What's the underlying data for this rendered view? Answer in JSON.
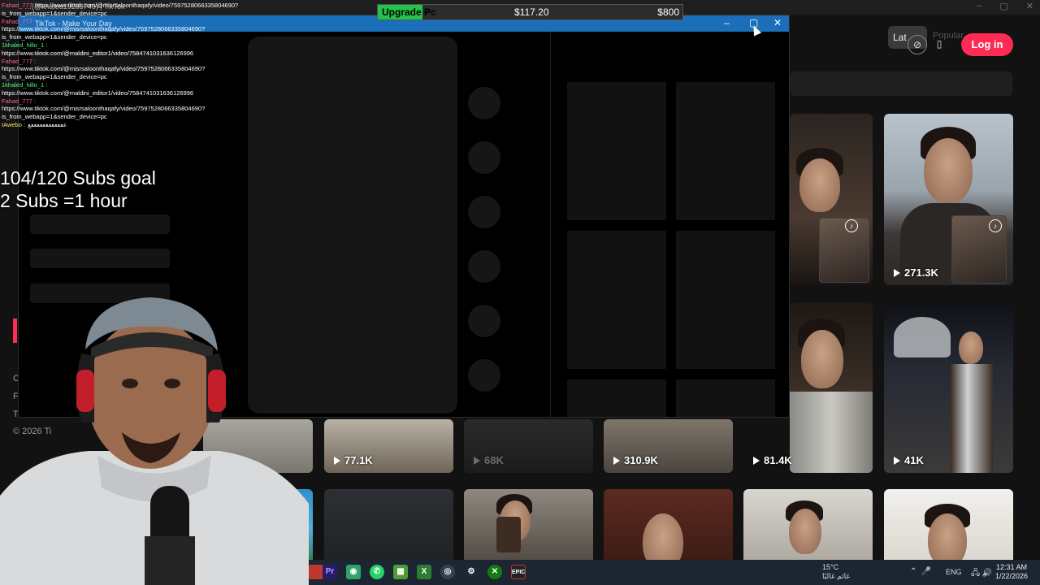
{
  "browser": {
    "title": "…(@khaled19283746) | TikTok",
    "window_title": "TikTok - Make Your Day"
  },
  "upgrade": {
    "label": "Upgrade Pc",
    "current": "$117.20",
    "goal": "$800",
    "progress": 0.1465
  },
  "tiktok": {
    "tab_latest": "Lat",
    "tab_popular": "Popular",
    "login_label": "Log in",
    "side_labels": [
      "C",
      "F",
      "T"
    ],
    "copyright": "© 2026 Ti",
    "tiles": [
      {
        "views": "271.3K"
      },
      {
        "views": "77.1K"
      },
      {
        "views": "68K"
      },
      {
        "views": "310.9K"
      },
      {
        "views": "81.4K"
      },
      {
        "views": "41K"
      }
    ]
  },
  "chat": [
    {
      "user": "Fahad_777",
      "text": "https://www.tiktok.com/@misrsaloonthaqafy/video/7597528066335804690?",
      "color": "pink"
    },
    {
      "user": "",
      "text": "is_from_webapp=1&sender_device=pc",
      "color": ""
    },
    {
      "user": "Fahad_777 :",
      "text": "",
      "color": "pink"
    },
    {
      "user": "",
      "text": "https://www.tiktok.com/@misrsaloonthaqafy/video/7597528066335804690?",
      "color": ""
    },
    {
      "user": "",
      "text": "is_from_webapp=1&sender_device=pc",
      "color": ""
    },
    {
      "user": "1khaled_hillo_1 :",
      "text": "",
      "color": "green"
    },
    {
      "user": "",
      "text": "https://www.tiktok.com/@maldini_editor1/video/7584741031636126996",
      "color": ""
    },
    {
      "user": "Fahad_777 :",
      "text": "",
      "color": "pink"
    },
    {
      "user": "",
      "text": "https://www.tiktok.com/@misrsaloonthaqafy/video/7597528066335804690?",
      "color": ""
    },
    {
      "user": "",
      "text": "is_from_webapp=1&sender_device=pc",
      "color": ""
    },
    {
      "user": "1khaled_hillo_1 :",
      "text": "",
      "color": "green"
    },
    {
      "user": "",
      "text": "https://www.tiktok.com/@maldini_editor1/video/7584741031636126996",
      "color": ""
    },
    {
      "user": "Fahad_777 :",
      "text": "",
      "color": "pink"
    },
    {
      "user": "",
      "text": "https://www.tiktok.com/@misrsaloonthaqafy/video/7597528066335804690?",
      "color": ""
    },
    {
      "user": "",
      "text": "is_from_webapp=1&sender_device=pc",
      "color": ""
    },
    {
      "user": "IAwebo :",
      "text": "ععععععععععععع",
      "color": "yellow"
    }
  ],
  "subs_goal": {
    "line1": "104/120 Subs goal",
    "line2": "2 Subs =1 hour"
  },
  "taskbar": {
    "weather_temp": "15°C",
    "weather_desc": "غائم غالبًا",
    "lang": "ENG",
    "time": "12:31 AM",
    "date": "1/22/2026"
  },
  "colors": {
    "tiktok_pink": "#fe2c55",
    "upgrade_green": "#24c24a",
    "title_blue": "#1a6fb8"
  }
}
